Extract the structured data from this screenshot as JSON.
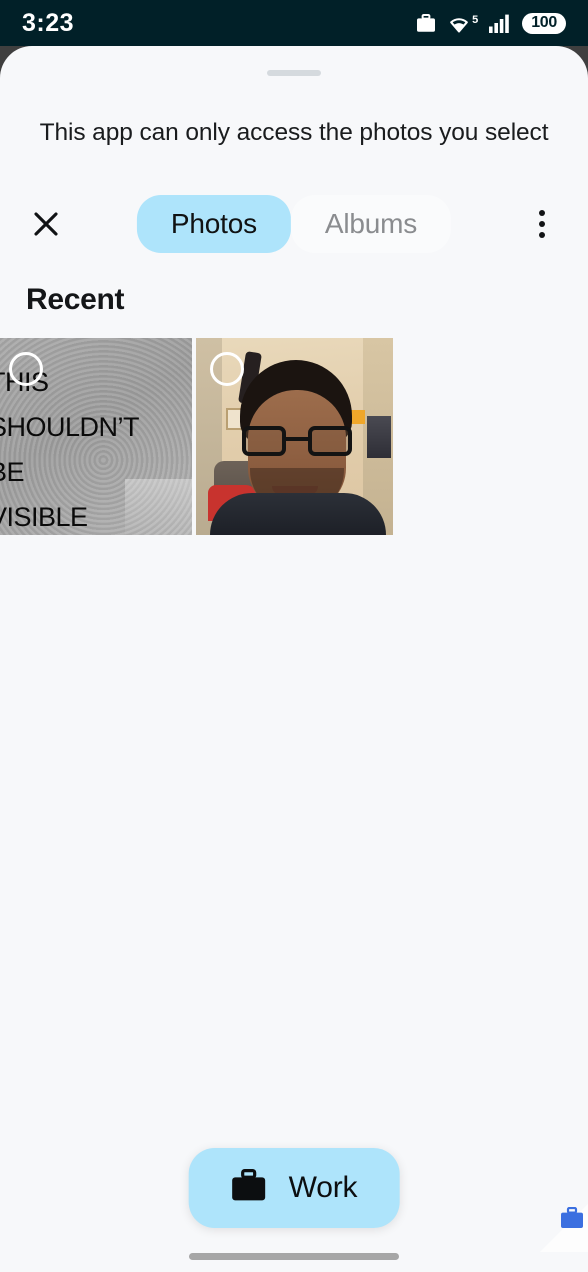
{
  "status_bar": {
    "time": "3:23",
    "battery_level": "100",
    "wifi_generation": "5",
    "icons": [
      "work-briefcase-icon",
      "wifi-icon",
      "cellular-signal-icon",
      "battery-icon"
    ],
    "background_color": "#012028",
    "foreground_color": "#ffffff"
  },
  "sheet": {
    "subtitle": "This app can only access the photos you select",
    "background_color": "#f7f8fa"
  },
  "toolbar": {
    "close_label": "×",
    "overflow_label": "More options",
    "tabs": [
      {
        "label": "Photos",
        "active": true
      },
      {
        "label": "Albums",
        "active": false
      }
    ],
    "active_tab_color": "#aee4fb",
    "inactive_tab_text_color": "#8a8c8f"
  },
  "gallery": {
    "section_title": "Recent",
    "items": [
      {
        "name": "photo-screen-text",
        "alt_text": "THIS SHOULDN'T BE VISIBLE",
        "overlay_lines": [
          "THIS",
          "SHOULDN’T",
          "BE",
          "VISIBLE"
        ],
        "selected": false
      },
      {
        "name": "photo-selfie-portrait",
        "alt_text": "Selfie portrait of a person with glasses",
        "selected": false
      }
    ]
  },
  "work_button": {
    "label": "Work",
    "icon": "briefcase-icon",
    "background_color": "#aee4fb",
    "text_color": "#0c0e10"
  },
  "corner_badge": {
    "icon": "work-briefcase-badge-icon",
    "color": "#3b6fe0"
  },
  "gesture_bar": {
    "color": "#a6a6a6"
  }
}
